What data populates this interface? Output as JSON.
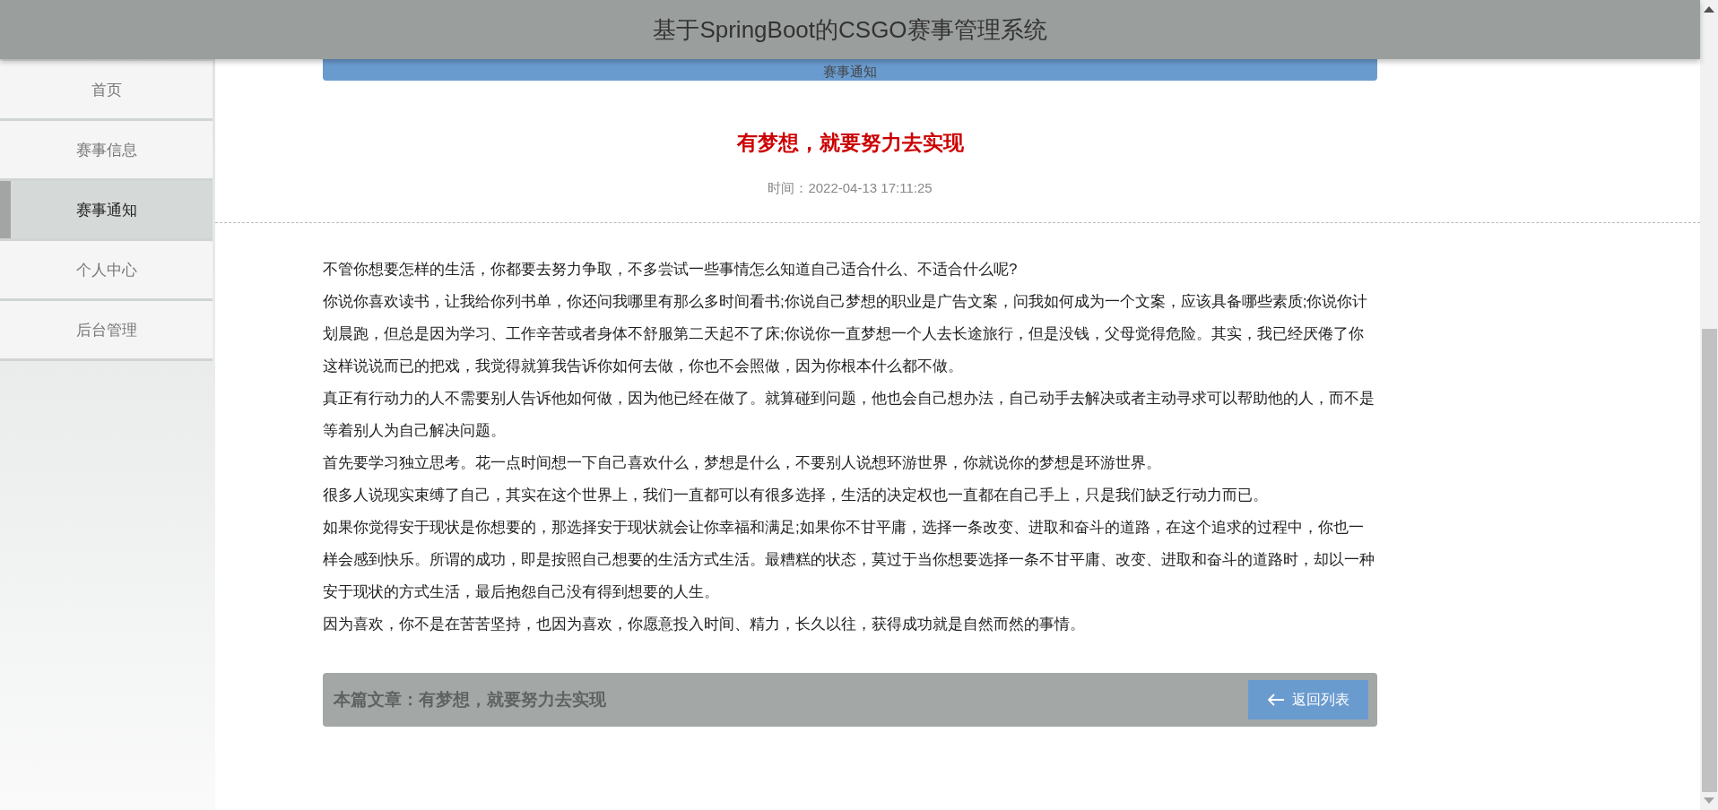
{
  "header": {
    "title": "基于SpringBoot的CSGO赛事管理系统"
  },
  "sidebar": {
    "items": [
      {
        "label": "首页",
        "selected": false
      },
      {
        "label": "赛事信息",
        "selected": false
      },
      {
        "label": "赛事通知",
        "selected": true
      },
      {
        "label": "个人中心",
        "selected": false
      },
      {
        "label": "后台管理",
        "selected": false
      }
    ]
  },
  "section_bar": {
    "label": "赛事通知"
  },
  "article": {
    "title": "有梦想，就要努力去实现",
    "time": "时间：2022-04-13 17:11:25",
    "paragraphs": [
      "不管你想要怎样的生活，你都要去努力争取，不多尝试一些事情怎么知道自己适合什么、不适合什么呢?",
      "你说你喜欢读书，让我给你列书单，你还问我哪里有那么多时间看书;你说自己梦想的职业是广告文案，问我如何成为一个文案，应该具备哪些素质;你说你计划晨跑，但总是因为学习、工作辛苦或者身体不舒服第二天起不了床;你说你一直梦想一个人去长途旅行，但是没钱，父母觉得危险。其实，我已经厌倦了你这样说说而已的把戏，我觉得就算我告诉你如何去做，你也不会照做，因为你根本什么都不做。",
      "真正有行动力的人不需要别人告诉他如何做，因为他已经在做了。就算碰到问题，他也会自己想办法，自己动手去解决或者主动寻求可以帮助他的人，而不是等着别人为自己解决问题。",
      "首先要学习独立思考。花一点时间想一下自己喜欢什么，梦想是什么，不要别人说想环游世界，你就说你的梦想是环游世界。",
      "很多人说现实束缚了自己，其实在这个世界上，我们一直都可以有很多选择，生活的决定权也一直都在自己手上，只是我们缺乏行动力而已。",
      "如果你觉得安于现状是你想要的，那选择安于现状就会让你幸福和满足;如果你不甘平庸，选择一条改变、进取和奋斗的道路，在这个追求的过程中，你也一样会感到快乐。所谓的成功，即是按照自己想要的生活方式生活。最糟糕的状态，莫过于当你想要选择一条不甘平庸、改变、进取和奋斗的道路时，却以一种安于现状的方式生活，最后抱怨自己没有得到想要的人生。",
      "因为喜欢，你不是在苦苦坚持，也因为喜欢，你愿意投入时间、精力，长久以往，获得成功就是自然而然的事情。"
    ]
  },
  "footer_bar": {
    "text": "本篇文章：有梦想，就要努力去实现",
    "button": "返回列表"
  }
}
